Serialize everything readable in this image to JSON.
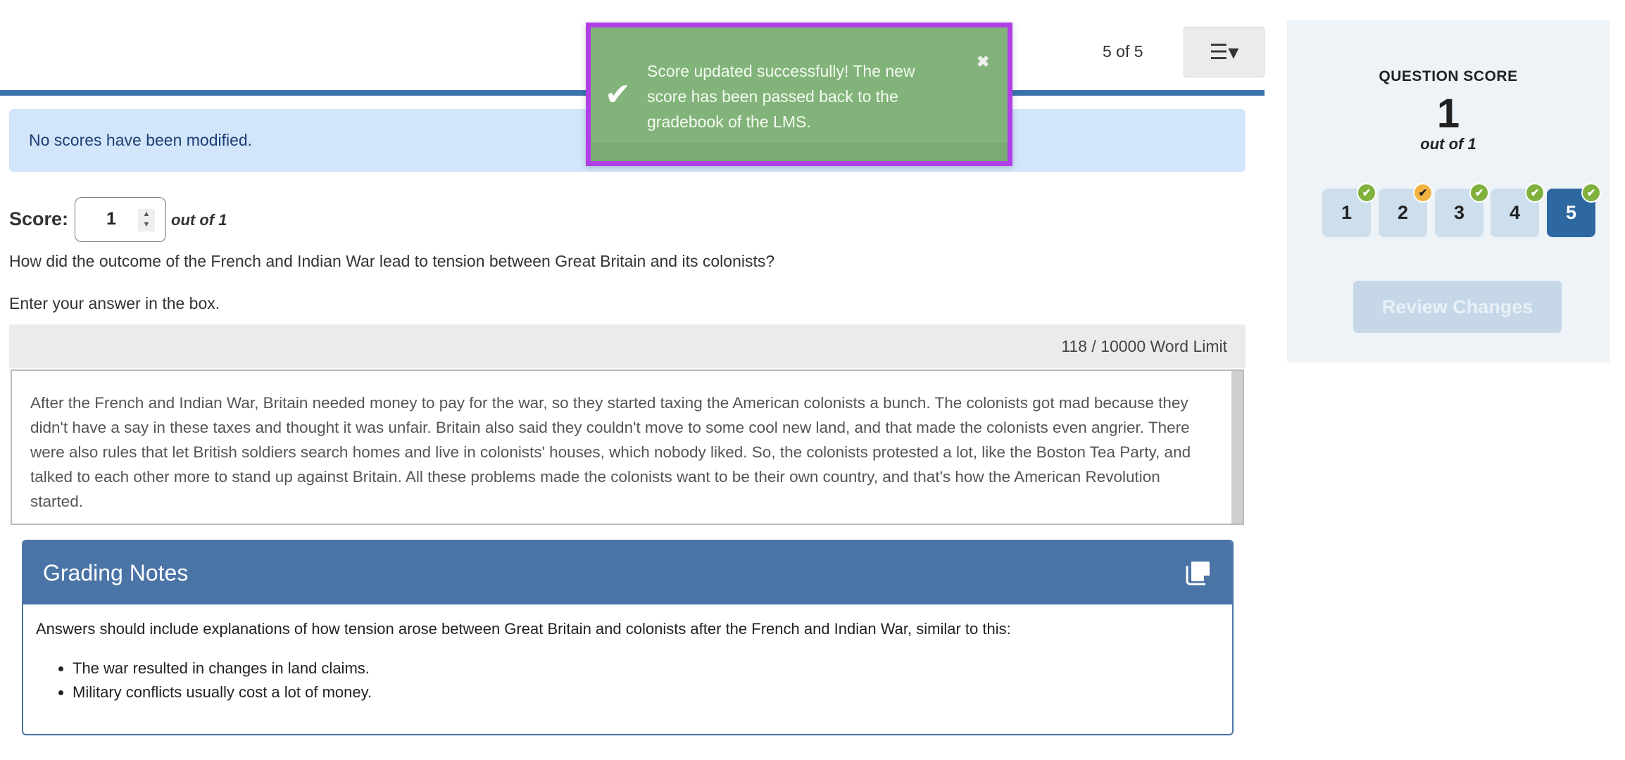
{
  "header": {
    "counter": "5 of 5",
    "menu_icon": "list-dropdown-icon"
  },
  "banner": {
    "text": "No scores have been modified."
  },
  "score": {
    "label": "Score:",
    "value": "1",
    "out_of": "out of 1"
  },
  "question": {
    "text": "How did the outcome of the French and Indian War lead to tension between Great Britain and its colonists?",
    "instruction": "Enter your answer in the box."
  },
  "answer": {
    "word_count": "118 / 10000 Word Limit",
    "text": "After the French and Indian War, Britain needed money to pay for the war, so they started taxing the American colonists a bunch. The colonists got mad because they didn't have a say in these taxes and thought it was unfair. Britain also said they couldn't move to some cool new land, and that made the colonists even angrier. There were also rules that let British soldiers search homes and live in colonists' houses, which nobody liked. So, the colonists protested a lot, like the Boston Tea Party, and talked to each other more to stand up against Britain. All these problems made the colonists want to be their own country, and that's how the American Revolution started."
  },
  "grading_notes": {
    "title": "Grading Notes",
    "intro": "Answers should include explanations of how tension arose between Great Britain and colonists after the French and Indian War, similar to this:",
    "bullets": [
      "The war resulted in changes in land claims.",
      "Military conflicts usually cost a lot of money."
    ]
  },
  "panel": {
    "title": "QUESTION SCORE",
    "value": "1",
    "out_of": "out of 1",
    "questions": [
      {
        "label": "1",
        "status": "graded"
      },
      {
        "label": "2",
        "status": "partial"
      },
      {
        "label": "3",
        "status": "graded"
      },
      {
        "label": "4",
        "status": "graded"
      },
      {
        "label": "5",
        "status": "graded",
        "active": true
      }
    ],
    "review_button": "Review Changes"
  },
  "toast": {
    "message": "Score updated successfully! The new score has been passed back to the gradebook of the LMS.",
    "close": "✖"
  },
  "colors": {
    "accent": "#3a74ad",
    "toast": "#82b37a",
    "highlight": "#b040e6",
    "badge_green": "#7fb13c",
    "badge_orange": "#f1b341"
  }
}
